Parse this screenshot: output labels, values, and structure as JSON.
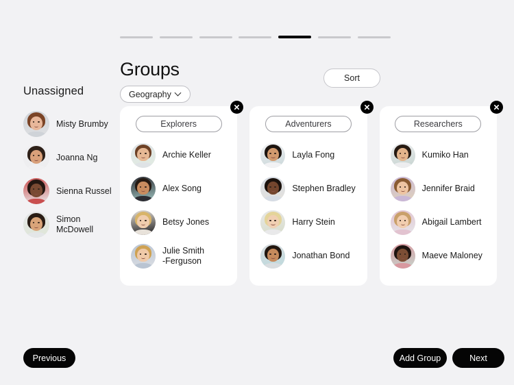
{
  "theme": {
    "background": "#f2f2f4",
    "card_background": "#ffffff",
    "accent": "#000000",
    "text": "#1b1b1b",
    "muted_border": "#c6c6cb",
    "step_inactive": "#c9c9cc"
  },
  "stepper": {
    "total_steps": 7,
    "active_index": 4
  },
  "header": {
    "title": "Groups",
    "filter_label": "Geography",
    "filter_icon": "chevron-down-icon",
    "sort_label": "Sort"
  },
  "sidebar": {
    "title": "Unassigned",
    "people": [
      {
        "name": "Misty Brumby",
        "avatar": {
          "skin": "#e8b79a",
          "hair": "#7b4426",
          "bg": "#dfe0e2",
          "top": "#cfd3d8"
        }
      },
      {
        "name": "Joanna Ng",
        "avatar": {
          "skin": "#d9a07a",
          "hair": "#2e2018",
          "bg": "#ededef",
          "top": "#f0f0f2"
        }
      },
      {
        "name": "Sienna Russel",
        "avatar": {
          "skin": "#7a4a33",
          "hair": "#241611",
          "bg": "#ebebed",
          "top": "#c94f4f"
        }
      },
      {
        "name": "Simon\nMcDowell",
        "avatar": {
          "skin": "#d9a479",
          "hair": "#2a1d15",
          "bg": "#dfe6d6",
          "top": "#e4e6e8"
        }
      }
    ]
  },
  "groups": [
    {
      "name": "Explorers",
      "close_icon": "close-icon",
      "members": [
        {
          "name": "Archie Keller",
          "avatar": {
            "skin": "#e6b894",
            "hair": "#6d4126",
            "bg": "#e2ece2",
            "top": "#dfe3e6"
          }
        },
        {
          "name": "Alex Song",
          "avatar": {
            "skin": "#c98c5f",
            "hair": "#261a12",
            "bg": "#9fc3c0",
            "top": "#2d2d33"
          }
        },
        {
          "name": "Betsy Jones",
          "avatar": {
            "skin": "#f0cdae",
            "hair": "#d8b469",
            "bg": "#1c1c1e",
            "top": "#e8e2da"
          }
        },
        {
          "name": "Julie Smith\n-Ferguson",
          "avatar": {
            "skin": "#efc9a8",
            "hair": "#cfa253",
            "bg": "#dcdfe4",
            "top": "#b9c4d2"
          }
        }
      ]
    },
    {
      "name": "Adventurers",
      "close_icon": "close-icon",
      "members": [
        {
          "name": "Layla Fong",
          "avatar": {
            "skin": "#d29a6e",
            "hair": "#1d1510",
            "bg": "#c8d6d8",
            "top": "#f2f2f4"
          }
        },
        {
          "name": "Stephen Bradley",
          "avatar": {
            "skin": "#74462e",
            "hair": "#1b120d",
            "bg": "#e5e2dd",
            "top": "#d6dce4"
          }
        },
        {
          "name": "Harry Stein",
          "avatar": {
            "skin": "#f0cfb2",
            "hair": "#e4d49a",
            "bg": "#d7dcc9",
            "top": "#e9e9ea"
          }
        },
        {
          "name": "Jonathan Bond",
          "avatar": {
            "skin": "#c58a5c",
            "hair": "#221710",
            "bg": "#bcd9dc",
            "top": "#d9dde0"
          }
        }
      ]
    },
    {
      "name": "Researchers",
      "close_icon": "close-icon",
      "members": [
        {
          "name": "Kumiko Han",
          "avatar": {
            "skin": "#e3b48b",
            "hair": "#261a12",
            "bg": "#c5d3cf",
            "top": "#ededef"
          }
        },
        {
          "name": "Jennifer Braid",
          "avatar": {
            "skin": "#eec4a2",
            "hair": "#8a5b32",
            "bg": "#e0d2bb",
            "top": "#c9b7d6"
          }
        },
        {
          "name": "Abigail Lambert",
          "avatar": {
            "skin": "#f1cdaf",
            "hair": "#c9a06a",
            "bg": "#e6e6ea",
            "top": "#e2c3d0"
          }
        },
        {
          "name": "Maeve Maloney",
          "avatar": {
            "skin": "#7c4e35",
            "hair": "#1e1410",
            "bg": "#c6d5cd",
            "top": "#d8989f"
          }
        }
      ]
    }
  ],
  "footer": {
    "previous_label": "Previous",
    "add_group_label": "Add Group",
    "next_label": "Next"
  }
}
